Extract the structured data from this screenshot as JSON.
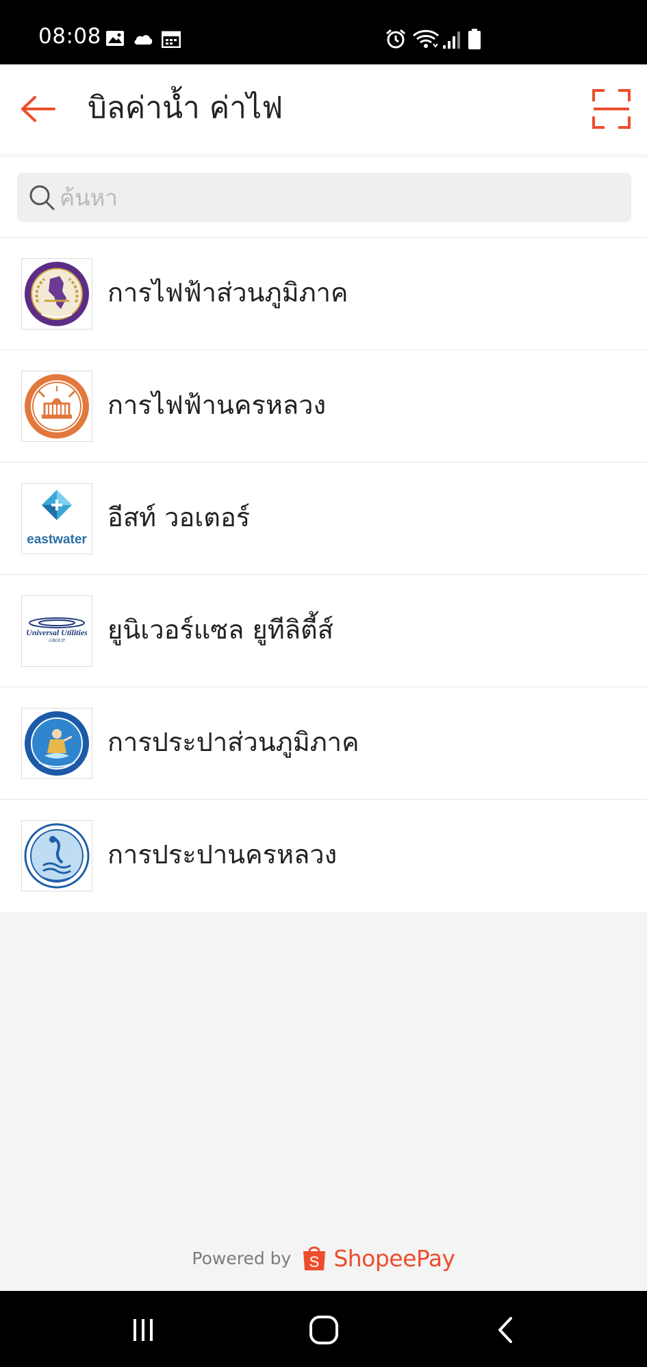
{
  "status_bar": {
    "time": "08:08",
    "left_icons": [
      "image-icon",
      "cloud-icon",
      "calendar-icon"
    ],
    "right_icons": [
      "alarm-icon",
      "wifi-icon",
      "signal-icon",
      "battery-icon"
    ]
  },
  "header": {
    "back_icon": "arrow-left-icon",
    "title": "บิลค่าน้ำ ค่าไฟ",
    "scan_icon": "scan-frame-icon"
  },
  "search": {
    "icon": "search-icon",
    "placeholder": "ค้นหา",
    "value": ""
  },
  "billers": [
    {
      "name": "การไฟฟ้าส่วนภูมิภาค",
      "logo": "pea-logo-icon"
    },
    {
      "name": "การไฟฟ้านครหลวง",
      "logo": "mea-logo-icon"
    },
    {
      "name": "อีสท์ วอเตอร์",
      "logo": "eastwater-logo-icon",
      "logo_text": "eastwater"
    },
    {
      "name": "ยูนิเวอร์แซล ยูทีลิตี้ส์",
      "logo": "universal-utilities-logo-icon",
      "logo_text": "Universal Utilities",
      "logo_subtext": "GROUP"
    },
    {
      "name": "การประปาส่วนภูมิภาค",
      "logo": "pwa-logo-icon"
    },
    {
      "name": "การประปานครหลวง",
      "logo": "mwa-logo-icon"
    }
  ],
  "footer": {
    "powered_by": "Powered by",
    "brand": "ShopeePay",
    "brand_icon": "shopee-bag-icon"
  },
  "nav_bar": {
    "buttons": [
      "recent-apps-icon",
      "home-icon",
      "back-icon"
    ]
  },
  "colors": {
    "accent": "#ee4d2d",
    "status_bar": "#000000",
    "background": "#f4f4f4",
    "search_bg": "#efefef"
  }
}
